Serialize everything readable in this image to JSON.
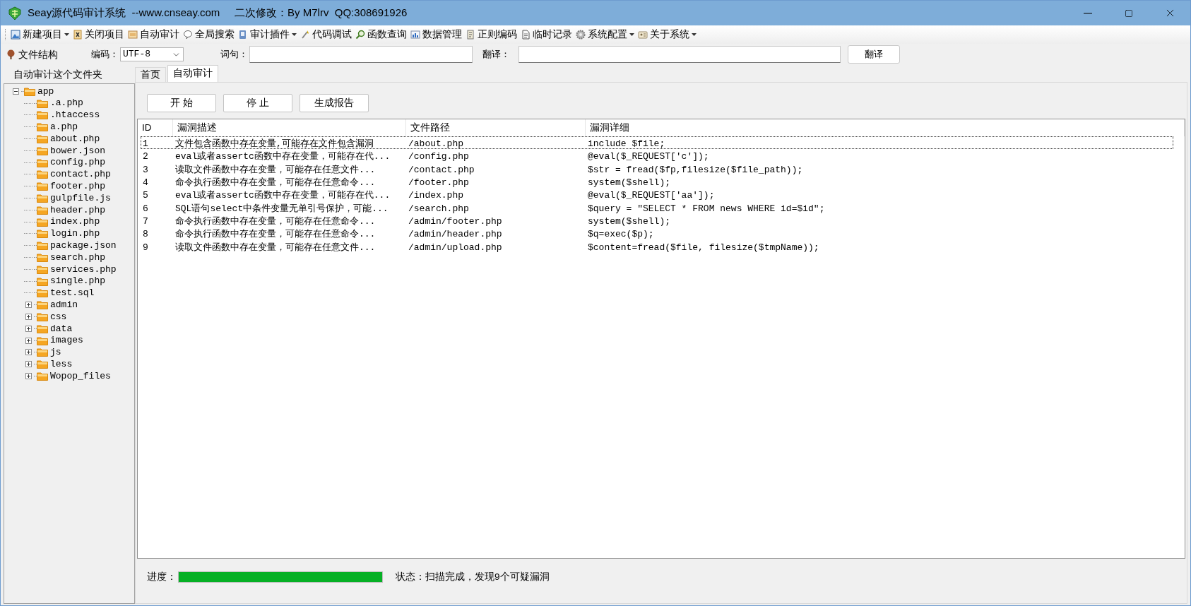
{
  "window": {
    "title": "Seay源代码审计系统  --www.cnseay.com     二次修改：By M7lrv  QQ:308691926"
  },
  "toolbar": [
    {
      "label": "新建项目",
      "has_menu": true
    },
    {
      "label": "关闭项目",
      "has_menu": false
    },
    {
      "label": "自动审计",
      "has_menu": false
    },
    {
      "label": "全局搜索",
      "has_menu": false
    },
    {
      "label": "审计插件",
      "has_menu": true
    },
    {
      "label": "代码调试",
      "has_menu": false
    },
    {
      "label": "函数查询",
      "has_menu": false
    },
    {
      "label": "数据管理",
      "has_menu": false
    },
    {
      "label": "正则编码",
      "has_menu": false
    },
    {
      "label": "临时记录",
      "has_menu": false
    },
    {
      "label": "系统配置",
      "has_menu": true
    },
    {
      "label": "关于系统",
      "has_menu": true
    }
  ],
  "file_structure_label": "文件结构",
  "encoding": {
    "label": "编码：",
    "value": "UTF-8"
  },
  "phrase": {
    "label": "词句："
  },
  "translation": {
    "label": "翻译：",
    "button": "翻译"
  },
  "left_panel": {
    "tab": "自动审计这个文件夹",
    "tree": [
      {
        "label": "app",
        "kind": "folder",
        "expanded": true,
        "children": [
          {
            "label": ".a.php",
            "kind": "file"
          },
          {
            "label": ".htaccess",
            "kind": "file"
          },
          {
            "label": "a.php",
            "kind": "file"
          },
          {
            "label": "about.php",
            "kind": "file"
          },
          {
            "label": "bower.json",
            "kind": "file"
          },
          {
            "label": "config.php",
            "kind": "file"
          },
          {
            "label": "contact.php",
            "kind": "file"
          },
          {
            "label": "footer.php",
            "kind": "file"
          },
          {
            "label": "gulpfile.js",
            "kind": "file"
          },
          {
            "label": "header.php",
            "kind": "file"
          },
          {
            "label": "index.php",
            "kind": "file"
          },
          {
            "label": "login.php",
            "kind": "file"
          },
          {
            "label": "package.json",
            "kind": "file"
          },
          {
            "label": "search.php",
            "kind": "file"
          },
          {
            "label": "services.php",
            "kind": "file"
          },
          {
            "label": "single.php",
            "kind": "file"
          },
          {
            "label": "test.sql",
            "kind": "file"
          },
          {
            "label": "admin",
            "kind": "folder",
            "expanded": false
          },
          {
            "label": "css",
            "kind": "folder",
            "expanded": false
          },
          {
            "label": "data",
            "kind": "folder",
            "expanded": false
          },
          {
            "label": "images",
            "kind": "folder",
            "expanded": false
          },
          {
            "label": "js",
            "kind": "folder",
            "expanded": false
          },
          {
            "label": "less",
            "kind": "folder",
            "expanded": false
          },
          {
            "label": "Wopop_files",
            "kind": "folder",
            "expanded": false
          }
        ]
      }
    ]
  },
  "tabs": [
    {
      "label": "首页",
      "selected": false
    },
    {
      "label": "自动审计",
      "selected": true
    }
  ],
  "actions": [
    "开 始",
    "停 止",
    "生成报告"
  ],
  "table": {
    "columns": [
      "ID",
      "漏洞描述",
      "文件路径",
      "漏洞详细"
    ],
    "rows": [
      {
        "cells": [
          "1",
          "文件包含函数中存在变量,可能存在文件包含漏洞",
          "/about.php",
          "include $file;"
        ],
        "selected": true
      },
      {
        "cells": [
          "2",
          "eval或者assertc函数中存在变量，可能存在代...",
          "/config.php",
          "@eval($_REQUEST['c']);"
        ],
        "selected": false
      },
      {
        "cells": [
          "3",
          "读取文件函数中存在变量，可能存在任意文件...",
          "/contact.php",
          "$str = fread($fp,filesize($file_path));"
        ],
        "selected": false
      },
      {
        "cells": [
          "4",
          "命令执行函数中存在变量，可能存在任意命令...",
          "/footer.php",
          "system($shell);"
        ],
        "selected": false
      },
      {
        "cells": [
          "5",
          "eval或者assertc函数中存在变量，可能存在代...",
          "/index.php",
          "@eval($_REQUEST['aa']);"
        ],
        "selected": false
      },
      {
        "cells": [
          "6",
          "SQL语句select中条件变量无单引号保护，可能...",
          "/search.php",
          "$query = \"SELECT * FROM news WHERE id=$id\";"
        ],
        "selected": false
      },
      {
        "cells": [
          "7",
          "命令执行函数中存在变量，可能存在任意命令...",
          "/admin/footer.php",
          "system($shell);"
        ],
        "selected": false
      },
      {
        "cells": [
          "8",
          "命令执行函数中存在变量，可能存在任意命令...",
          "/admin/header.php",
          "$q=exec($p);"
        ],
        "selected": false
      },
      {
        "cells": [
          "9",
          "读取文件函数中存在变量，可能存在任意文件...",
          "/admin/upload.php",
          "$content=fread($file, filesize($tmpName));"
        ],
        "selected": false
      }
    ]
  },
  "progress": {
    "label": "进度：",
    "level": 1.0
  },
  "status": "状态：扫描完成，发现9个可疑漏洞"
}
